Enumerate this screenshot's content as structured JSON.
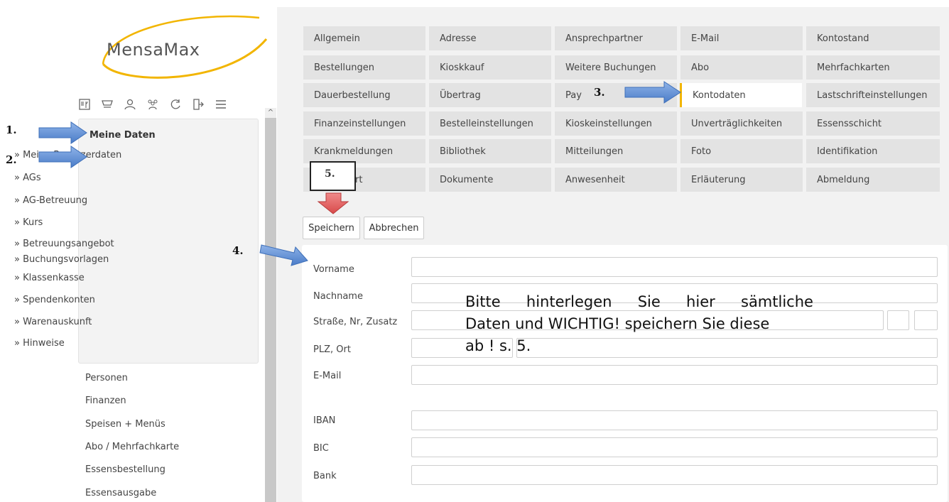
{
  "app": {
    "logo": "MensaMax"
  },
  "toolbar": {
    "icons": [
      "menu-plan-icon",
      "cart-icon",
      "user-icon",
      "group-icon",
      "refresh-icon",
      "logout-icon",
      "hamburger-icon"
    ]
  },
  "sidebar": {
    "section_title": "Meine Daten",
    "subitems": [
      "» Meine Benutzerdaten",
      "» AGs",
      "» AG-Betreuung",
      "» Kurs",
      "» Betreuungsangebot",
      "» Buchungsvorlagen",
      "» Klassenkasse",
      "» Spendenkonten",
      "» Warenauskunft",
      "» Hinweise"
    ],
    "nav": [
      "Personen",
      "Finanzen",
      "Speisen + Menüs",
      "Abo / Mehrfachkarte",
      "Essensbestellung",
      "Essensausgabe"
    ]
  },
  "tabs": [
    [
      "Allgemein",
      "Adresse",
      "Ansprechpartner",
      "E-Mail",
      "Kontostand"
    ],
    [
      "Bestellungen",
      "Kioskkauf",
      "Weitere Buchungen",
      "Abo",
      "Mehrfachkarten"
    ],
    [
      "Dauerbestellung",
      "Übertrag",
      "Pay",
      "Kontodaten",
      "Lastschrifteinstellungen"
    ],
    [
      "Finanzeinstellungen",
      "Bestelleinstellungen",
      "Kioskeinstellungen",
      "Unverträglichkeiten",
      "Essensschicht"
    ],
    [
      "Krankmeldungen",
      "Bibliothek",
      "Mitteilungen",
      "Foto",
      "Identifikation"
    ],
    [
      "rt",
      "Dokumente",
      "Anwesenheit",
      "Erläuterung",
      "Abmeldung"
    ]
  ],
  "active_tab": "Kontodaten",
  "buttons": {
    "save": "Speichern",
    "cancel": "Abbrechen"
  },
  "form": {
    "labels": [
      "Vorname",
      "Nachname",
      "Straße, Nr, Zusatz",
      "PLZ, Ort",
      "E-Mail",
      "IBAN",
      "BIC",
      "Bank"
    ]
  },
  "annotations": {
    "n1": "1.",
    "n2": "2.",
    "n3": "3.",
    "n4": "4.",
    "n5": "5.",
    "note_words": [
      "Bitte",
      "hinterlegen",
      "Sie",
      "hier",
      "sämtliche"
    ],
    "note_line2": "Daten und WICHTIG! speichern Sie diese",
    "note_line3": "ab ! s. 5."
  },
  "colors": {
    "accent": "#f2b500",
    "arrow_blue": "#5b8ed6",
    "arrow_red": "#e05050"
  }
}
